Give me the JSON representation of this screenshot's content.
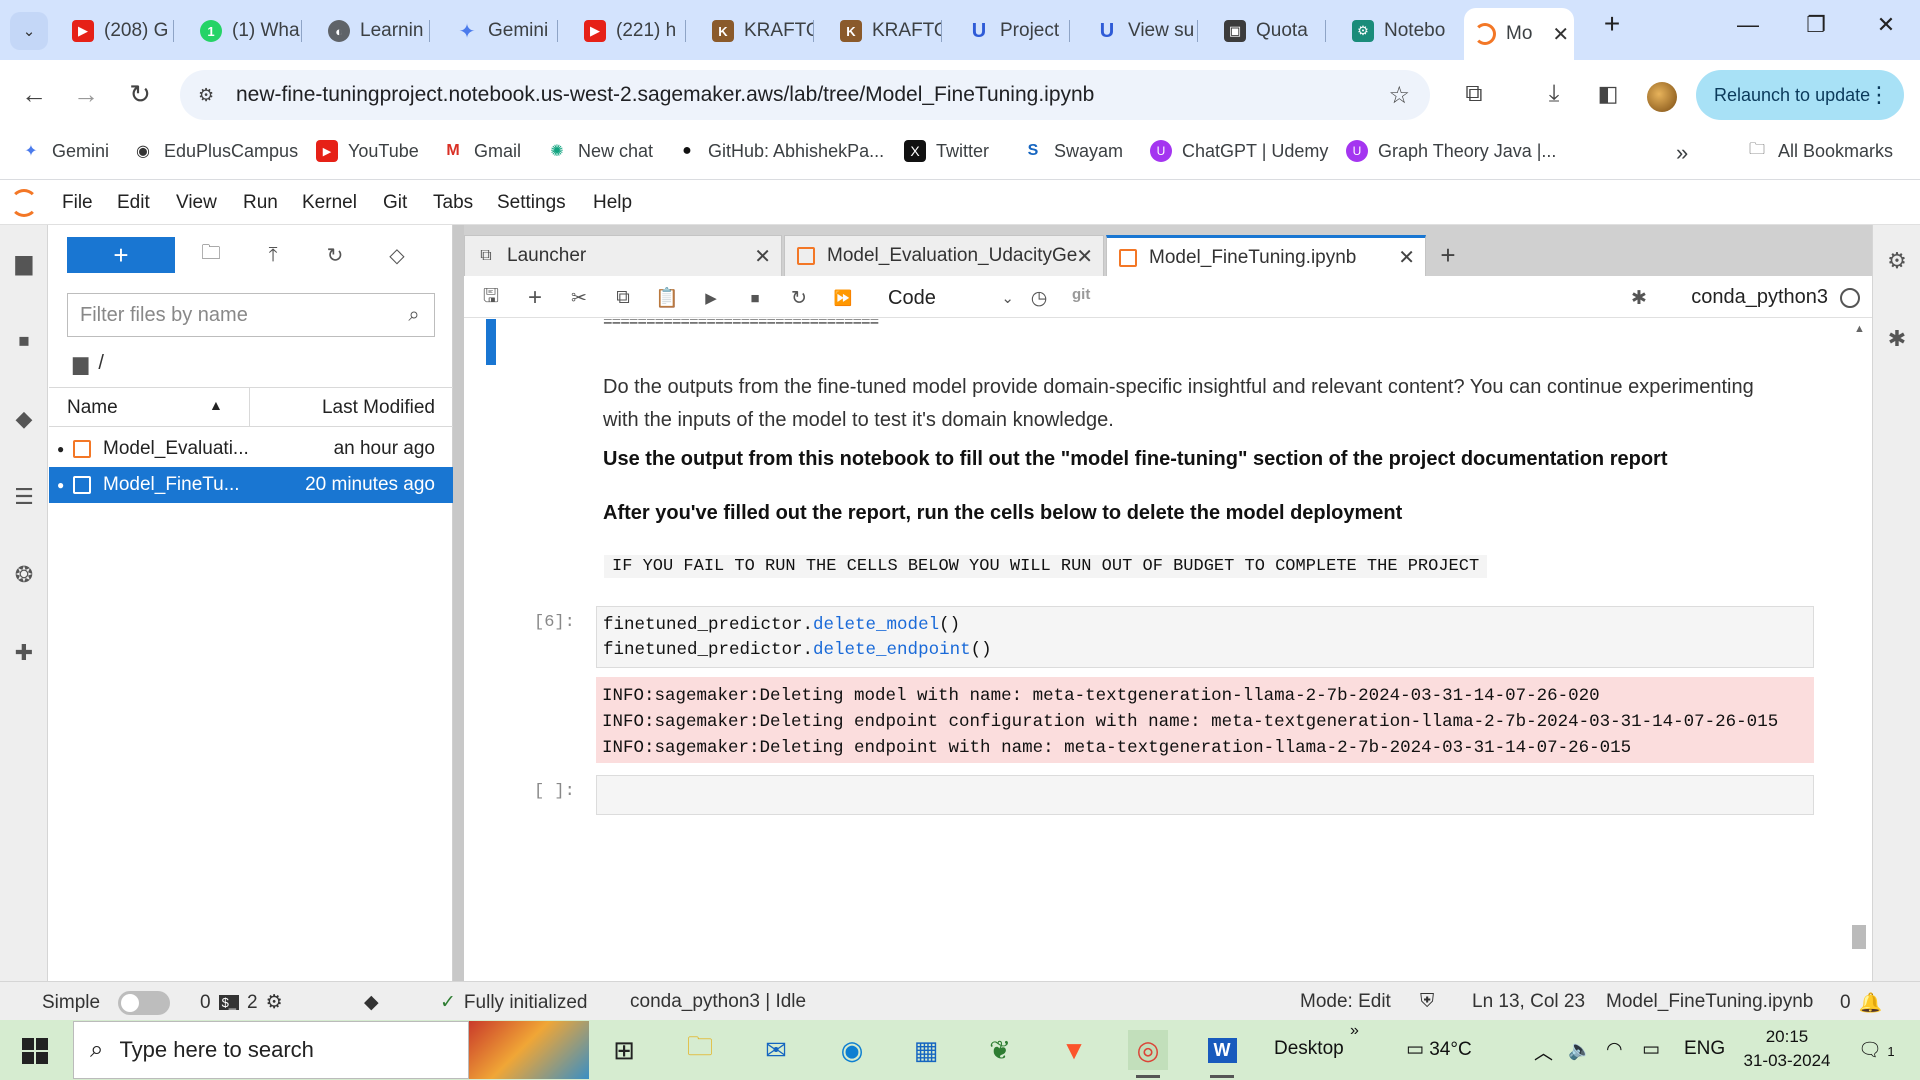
{
  "browser": {
    "tabs": [
      {
        "label": "(208) G",
        "icon": "youtube-icon",
        "color": "#e62117"
      },
      {
        "label": "(1) Wha",
        "icon": "whatsapp-icon",
        "color": "#25d366"
      },
      {
        "label": "Learnin",
        "icon": "globe-icon",
        "color": "#5f6368"
      },
      {
        "label": "Gemini",
        "icon": "gemini-icon",
        "color": "#4b7bec"
      },
      {
        "label": "(221) h",
        "icon": "youtube-icon",
        "color": "#e62117"
      },
      {
        "label": "KRAFTO",
        "icon": "krafton-icon",
        "color": "#8a5a2b"
      },
      {
        "label": "KRAFTO",
        "icon": "krafton-icon",
        "color": "#8a5a2b"
      },
      {
        "label": "Project",
        "icon": "udacity-icon",
        "color": "#2e5bd7"
      },
      {
        "label": "View su",
        "icon": "udacity-icon",
        "color": "#2e5bd7"
      },
      {
        "label": "Quota",
        "icon": "aws-icon",
        "color": "#3c3c3c"
      },
      {
        "label": "Notebo",
        "icon": "sagemaker-icon",
        "color": "#1a8c7a"
      },
      {
        "label": "Mo",
        "icon": "jupyter-icon",
        "color": "#f37726"
      }
    ],
    "url": "new-fine-tuningproject.notebook.us-west-2.sagemaker.aws/lab/tree/Model_FineTuning.ipynb",
    "relaunch_label": "Relaunch to update",
    "bookmarks": [
      {
        "label": "Gemini",
        "icon": "gemini-icon"
      },
      {
        "label": "EduPlusCampus",
        "icon": "globe-icon"
      },
      {
        "label": "YouTube",
        "icon": "youtube-icon"
      },
      {
        "label": "Gmail",
        "icon": "gmail-icon"
      },
      {
        "label": "New chat",
        "icon": "chatgpt-icon"
      },
      {
        "label": "GitHub: AbhishekPa...",
        "icon": "github-icon"
      },
      {
        "label": "Twitter",
        "icon": "x-icon"
      },
      {
        "label": "Swayam",
        "icon": "swayam-icon"
      },
      {
        "label": "ChatGPT | Udemy",
        "icon": "udemy-icon"
      },
      {
        "label": "Graph Theory Java |...",
        "icon": "udemy-icon"
      }
    ],
    "all_bookmarks": "All Bookmarks"
  },
  "menu": [
    "File",
    "Edit",
    "View",
    "Run",
    "Kernel",
    "Git",
    "Tabs",
    "Settings",
    "Help"
  ],
  "filebrowser": {
    "filter_placeholder": "Filter files by name",
    "breadcrumb": "/",
    "col_name": "Name",
    "col_modified": "Last Modified",
    "files": [
      {
        "name": "Model_Evaluati...",
        "modified": "an hour ago",
        "selected": false
      },
      {
        "name": "Model_FineTu...",
        "modified": "20 minutes ago",
        "selected": true
      }
    ]
  },
  "doc_tabs": [
    {
      "label": "Launcher",
      "icon": "launcher-icon"
    },
    {
      "label": "Model_Evaluation_UdacityGe",
      "icon": "notebook-icon"
    },
    {
      "label": "Model_FineTuning.ipynb",
      "icon": "notebook-icon",
      "active": true
    }
  ],
  "notebook": {
    "cell_type": "Code",
    "git_label": "git",
    "kernel": "conda_python3",
    "eq_line": "================================",
    "para1": "Do the outputs from the fine-tuned model provide domain-specific insightful and relevant content? You can continue experimenting with the inputs of the model to test it's domain knowledge.",
    "para2": "Use the output from this notebook to fill out the \"model fine-tuning\" section of the project documentation report",
    "para3": "After you've filled out the report, run the cells below to delete the model deployment",
    "warning_code": "IF YOU FAIL TO RUN THE CELLS BELOW YOU WILL RUN OUT OF BUDGET TO COMPLETE THE PROJECT",
    "cell6": {
      "prompt": "[6]:",
      "line1_obj": "finetuned_predictor.",
      "line1_fn": "delete_model",
      "line1_end": "()",
      "line2_obj": "finetuned_predictor.",
      "line2_fn": "delete_endpoint",
      "line2_end": "()",
      "output": [
        "INFO:sagemaker:Deleting model with name: meta-textgeneration-llama-2-7b-2024-03-31-14-07-26-020",
        "INFO:sagemaker:Deleting endpoint configuration with name: meta-textgeneration-llama-2-7b-2024-03-31-14-07-26-015",
        "INFO:sagemaker:Deleting endpoint with name: meta-textgeneration-llama-2-7b-2024-03-31-14-07-26-015"
      ]
    },
    "empty_prompt": "[ ]:"
  },
  "statusbar": {
    "mode_label": "Simple",
    "terminals": "0",
    "kernels": "2",
    "init": "Fully initialized",
    "kernel_status": "conda_python3 | Idle",
    "mode": "Mode: Edit",
    "position": "Ln 13, Col 23",
    "file": "Model_FineTuning.ipynb",
    "notifications": "0"
  },
  "taskbar": {
    "search_placeholder": "Type here to search",
    "desktop": "Desktop",
    "temperature": "34°C",
    "lang": "ENG",
    "time": "20:15",
    "date": "31-03-2024",
    "notif_count": "1"
  },
  "colors": {
    "jupyter_orange": "#f37726",
    "selection_blue": "#1976d2",
    "error_output": "#fbdddd"
  }
}
